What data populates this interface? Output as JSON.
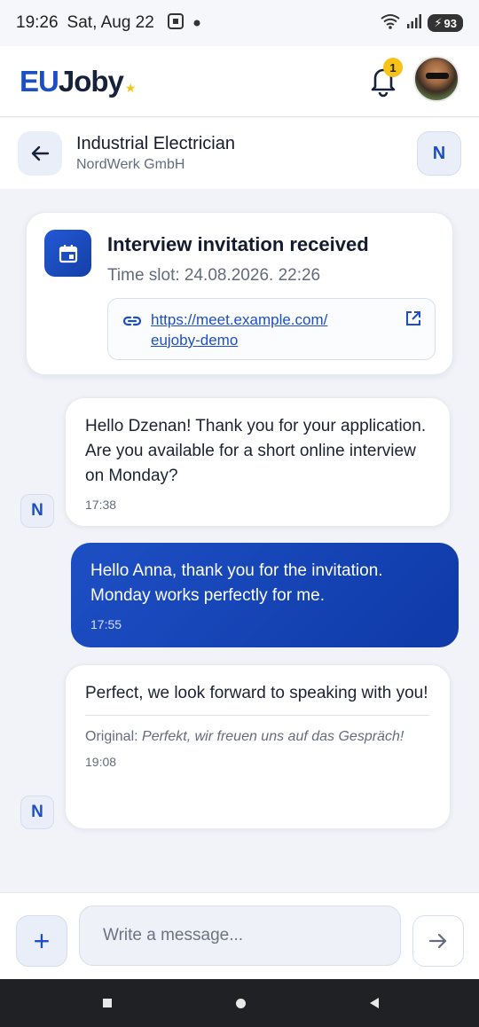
{
  "status_bar": {
    "time": "19:26",
    "date": "Sat, Aug 22",
    "battery": "93"
  },
  "app": {
    "logo_eu": "EU",
    "logo_joby": "Joby",
    "logo_star": "★",
    "notification_count": "1"
  },
  "chat_header": {
    "title": "Industrial Electrician",
    "company": "NordWerk GmbH",
    "avatar_initial": "N"
  },
  "invitation": {
    "title": "Interview invitation received",
    "time_slot": "Time slot: 24.08.2026. 22:26",
    "link_line1": "https://meet.example.com/",
    "link_line2": "eujoby-demo"
  },
  "messages": [
    {
      "direction": "incoming",
      "text": "Hello Dzenan! Thank you for your application. Are you available for a short online interview on Monday?",
      "time": "17:38",
      "sender_initial": "N"
    },
    {
      "direction": "outgoing",
      "text": "Hello Anna, thank you for the invitation. Monday works perfectly for me.",
      "time": "17:55"
    },
    {
      "direction": "incoming",
      "text": "Perfect, we look forward to speaking with you!",
      "original_label": "Original:",
      "original_text": "Perfekt, wir freuen uns auf das Gespräch!",
      "time": "19:08",
      "sender_initial": "N"
    }
  ],
  "composer": {
    "placeholder": "Write a message...",
    "plus_label": "+"
  },
  "colors": {
    "primary": "#1d4fc4",
    "badge": "#f7c31a",
    "background": "#f1f3f8"
  }
}
